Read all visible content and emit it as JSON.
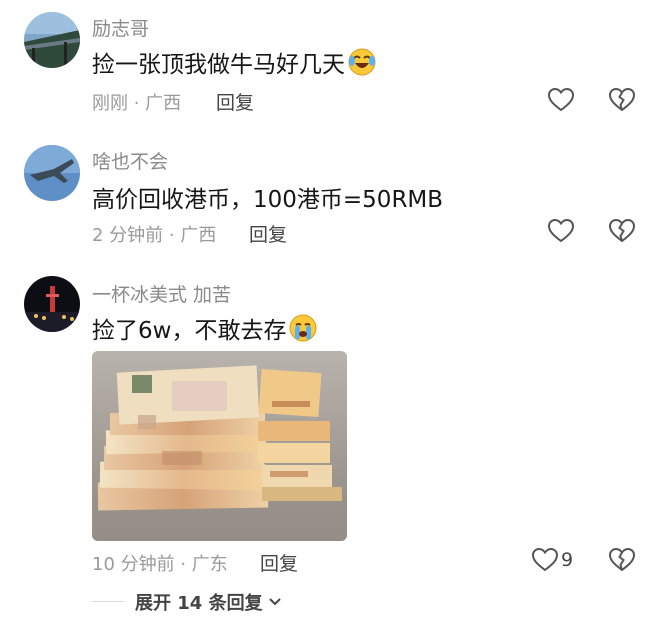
{
  "comments": [
    {
      "username": "励志哥",
      "text": "捡一张顶我做牛马好几天",
      "emoji": "laughing-crying-emoji",
      "meta": "刚刚 · 广西",
      "reply_label": "回复",
      "likes": ""
    },
    {
      "username": "啥也不会",
      "text": "高价回收港币，100港币=50RMB",
      "meta": "2 分钟前 · 广西",
      "reply_label": "回复",
      "likes": ""
    },
    {
      "username": "一杯冰美式 加苦",
      "text": "捡了6w，不敢去存",
      "emoji": "crying-emoji",
      "meta": "10 分钟前 · 广东",
      "reply_label": "回复",
      "likes": "9"
    }
  ],
  "expand_label": "展开 14 条回复",
  "icons": [
    "heart-icon",
    "broken-heart-icon",
    "chevron-down-icon"
  ],
  "colors": {
    "meta": "#9a9a9a",
    "username": "#8a8a8a",
    "text": "#161616",
    "icon": "#555555"
  }
}
